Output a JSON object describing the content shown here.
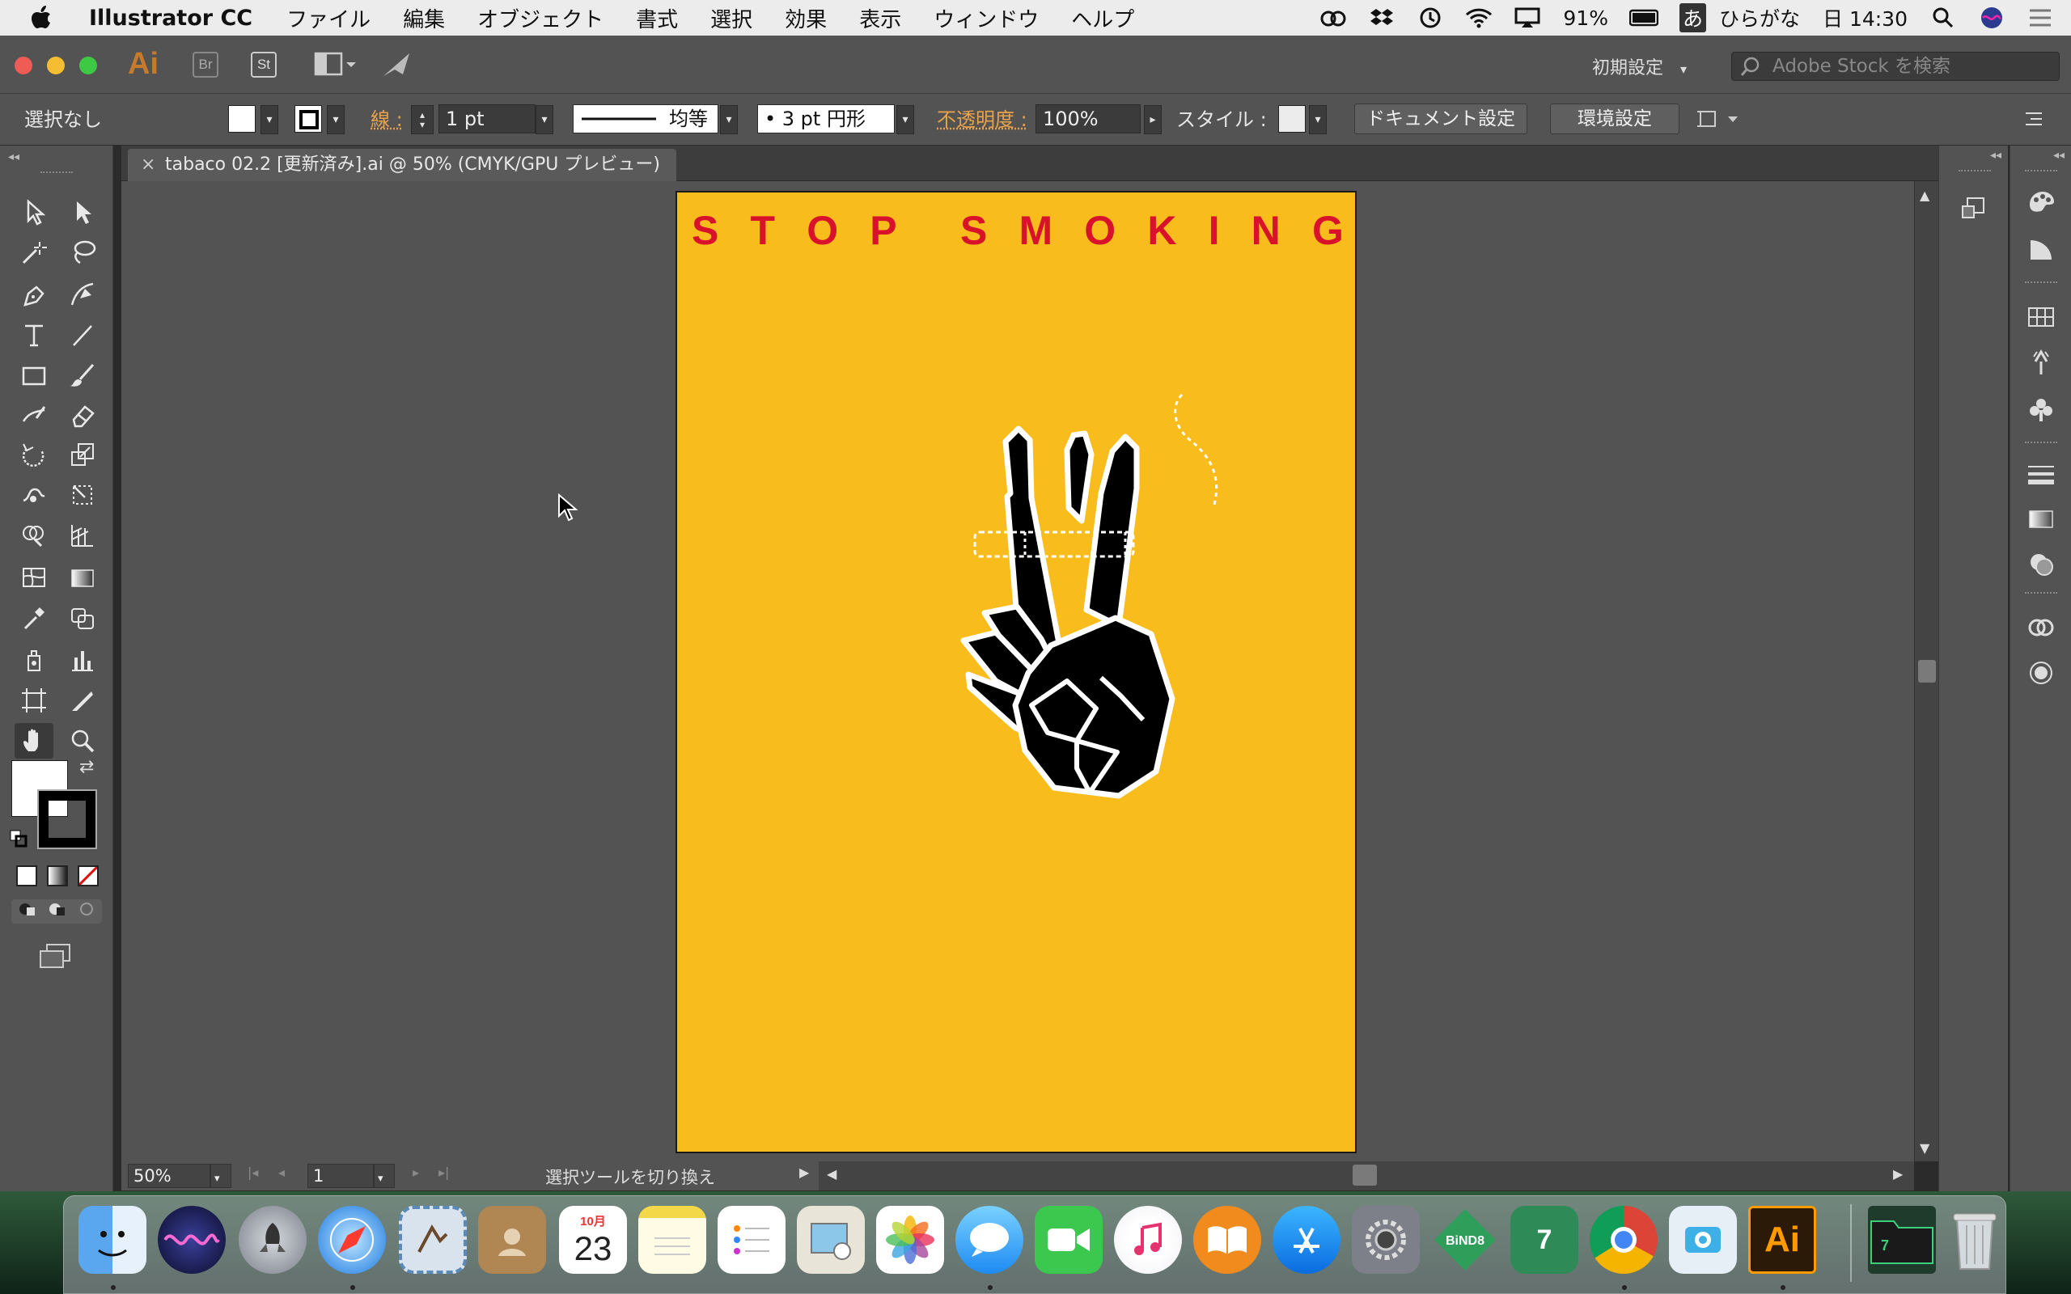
{
  "menubar": {
    "app_name": "Illustrator CC",
    "menus": [
      "ファイル",
      "編集",
      "オブジェクト",
      "書式",
      "選択",
      "効果",
      "表示",
      "ウィンドウ",
      "ヘルプ"
    ],
    "battery": "91%",
    "input_mode_glyph": "あ",
    "input_mode": "ひらがな",
    "clock": "日 14:30"
  },
  "titlebar": {
    "app_logo": "Ai",
    "bridge_label": "Br",
    "stock_label": "St",
    "workspace": "初期設定",
    "stock_search_placeholder": "Adobe Stock を検索"
  },
  "controlbar": {
    "selection_status": "選択なし",
    "stroke_label": "線 :",
    "stroke_weight": "1 pt",
    "stroke_profile": "均等",
    "brush": "•  3 pt 円形",
    "opacity_label": "不透明度 :",
    "opacity_value": "100%",
    "style_label": "スタイル :",
    "document_setup": "ドキュメント設定",
    "preferences": "環境設定"
  },
  "document": {
    "tab_title": "tabaco 02.2 [更新済み].ai @ 50% (CMYK/GPU プレビュー)",
    "close_glyph": "×",
    "poster_title": "STOP SMOKING",
    "poster_title_letters": [
      "S",
      "T",
      "O",
      "P",
      "S",
      "M",
      "O",
      "K",
      "I",
      "N",
      "G"
    ]
  },
  "statusbar": {
    "zoom": "50%",
    "artboard_number": "1",
    "status_text": "選択ツールを切り換え"
  },
  "colors": {
    "artboard_bg": "#f8bd1d",
    "title_red": "#d9122c",
    "panel_gray": "#535353",
    "ai_orange": "#c67a2c"
  },
  "dock": {
    "items": [
      "finder",
      "siri",
      "launchpad",
      "safari",
      "mail",
      "contacts",
      "calendar",
      "notes",
      "reminders",
      "maps-preview",
      "photos",
      "messages",
      "facetime",
      "itunes",
      "ibooks",
      "app-store",
      "system-preferences",
      "bind8",
      "bind7",
      "chrome",
      "photo-booth",
      "illustrator",
      "bind7-folder",
      "trash"
    ],
    "calendar_month": "10月",
    "calendar_day": "23",
    "bind8_label": "BiND8",
    "bind7_label": "7",
    "illustrator_label": "Ai"
  }
}
